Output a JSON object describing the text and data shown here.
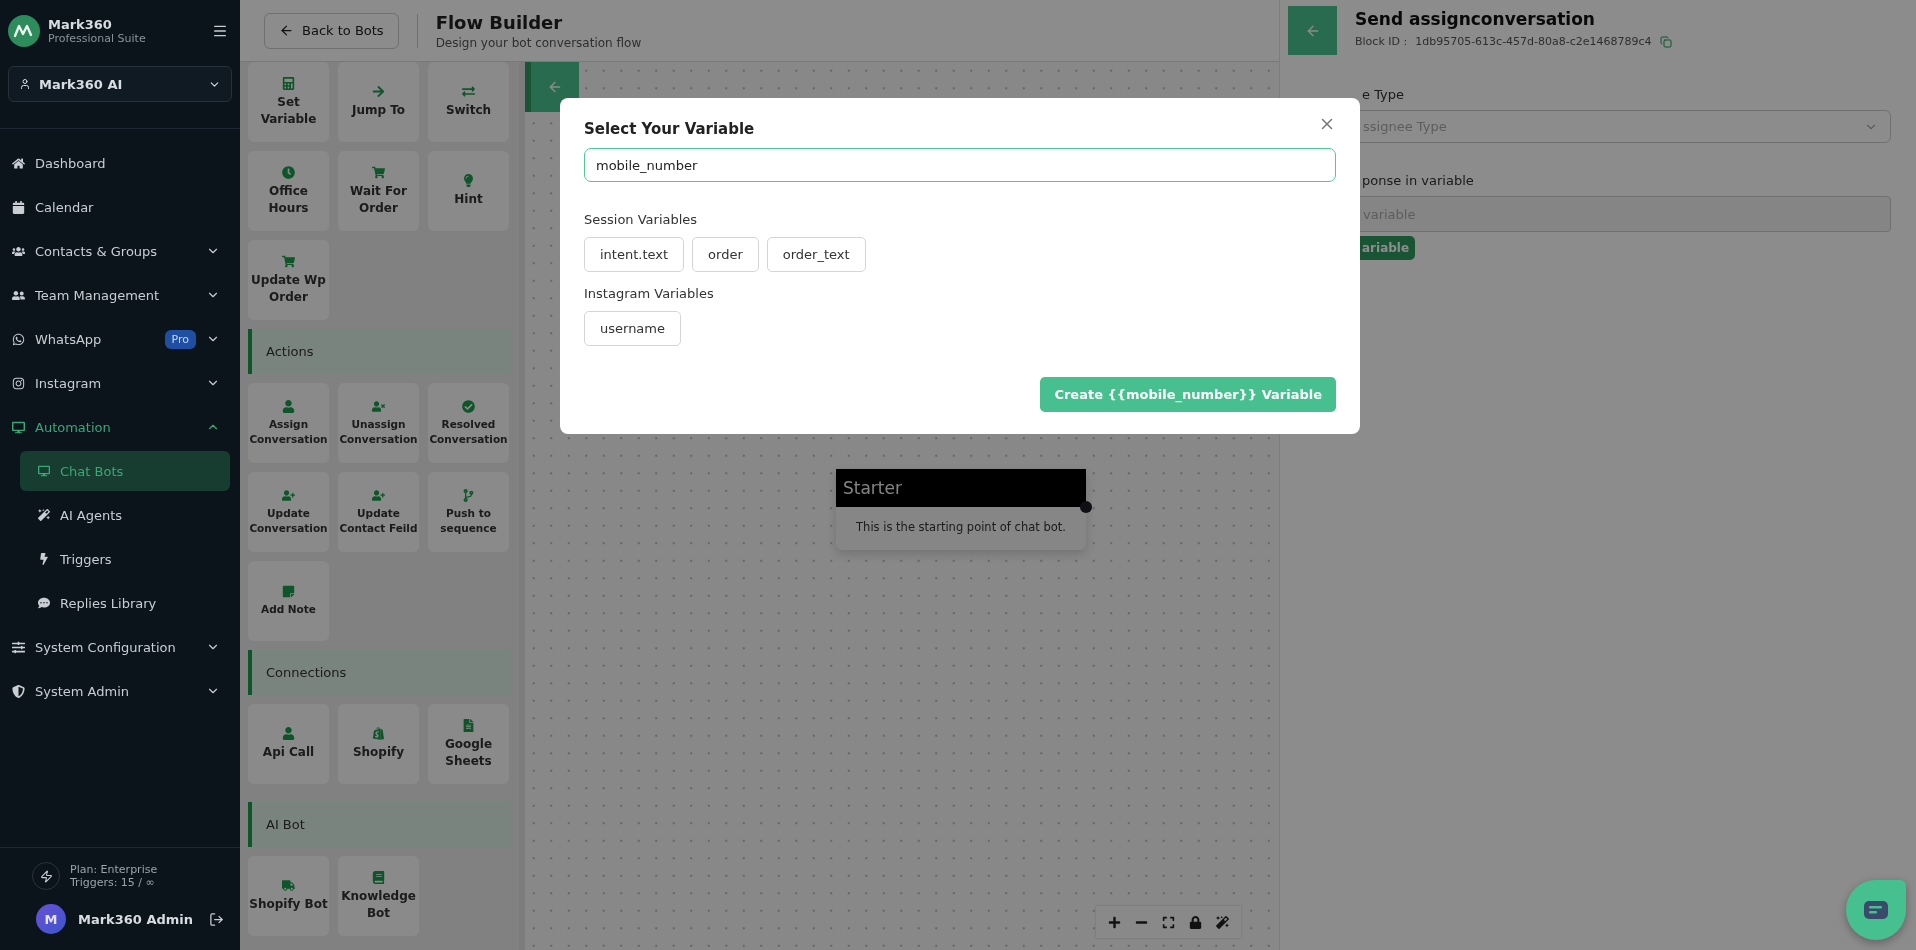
{
  "sidebar": {
    "brand": {
      "name": "Mark360",
      "subtitle": "Professional Suite"
    },
    "workspace": "Mark360 AI",
    "nav": [
      {
        "kind": "link",
        "label": "Dashboard",
        "active": false
      },
      {
        "kind": "link",
        "label": "Calendar",
        "active": false
      },
      {
        "kind": "group",
        "label": "Contacts & Groups",
        "active": false,
        "expanded": false
      },
      {
        "kind": "group",
        "label": "Team Management",
        "active": false,
        "expanded": false
      },
      {
        "kind": "group",
        "label": "WhatsApp",
        "badge": "Pro",
        "active": false,
        "expanded": false
      },
      {
        "kind": "group",
        "label": "Instagram",
        "active": false,
        "expanded": false
      },
      {
        "kind": "group",
        "label": "Automation",
        "active": true,
        "expanded": true,
        "children": [
          {
            "label": "Chat Bots",
            "selected": true
          },
          {
            "label": "AI Agents",
            "selected": false
          },
          {
            "label": "Triggers",
            "selected": false
          },
          {
            "label": "Replies Library",
            "selected": false
          }
        ]
      },
      {
        "kind": "group",
        "label": "System Configuration",
        "active": false,
        "expanded": false
      },
      {
        "kind": "group",
        "label": "System Admin",
        "active": false,
        "expanded": false
      }
    ],
    "plan": {
      "plan": "Plan: Enterprise",
      "triggers": "Triggers: 15 / ∞"
    },
    "user": {
      "initial": "M",
      "name": "Mark360 Admin"
    }
  },
  "header": {
    "back_button": "Back to Bots",
    "title": "Flow Builder",
    "subtitle": "Design your bot conversation flow"
  },
  "palette": [
    {
      "blocks": [
        "Set Variable",
        "Jump To",
        "Switch",
        "Office Hours",
        "Wait For Order",
        "Hint",
        "Update Wp Order"
      ]
    },
    {
      "title": "Actions",
      "blocks": [
        "Assign Conversation",
        "Unassign Conversation",
        "Resolved Conversation",
        "Update Conversation",
        "Update Contact Feild",
        "Push to sequence",
        "Add Note"
      ]
    },
    {
      "title": "Connections",
      "blocks": [
        "Api Call",
        "Shopify",
        "Google Sheets"
      ]
    },
    {
      "title": "AI Bot",
      "blocks": [
        "Shopify Bot",
        "Knowledge Bot"
      ]
    }
  ],
  "canvas": {
    "node": {
      "title": "Starter",
      "text": "This is the starting point of chat bot."
    }
  },
  "panel": {
    "title": "Send assignconversation",
    "block_id_label": "Block ID :",
    "block_id": "1db95705-613c-457d-80a8-c2e1468789c4",
    "type_label": "e Type",
    "type_placeholder": "ssignee Type",
    "var_label": "ponse in variable",
    "var_placeholder": "variable",
    "var_button": "ariable"
  },
  "modal": {
    "title": "Select Your Variable",
    "value": "mobile_number",
    "groups": [
      {
        "title": "Session Variables",
        "chips": [
          "intent.text",
          "order",
          "order_text"
        ]
      },
      {
        "title": "Instagram Variables",
        "chips": [
          "username"
        ]
      }
    ],
    "create_button": "Create {{mobile_number}} Variable"
  }
}
